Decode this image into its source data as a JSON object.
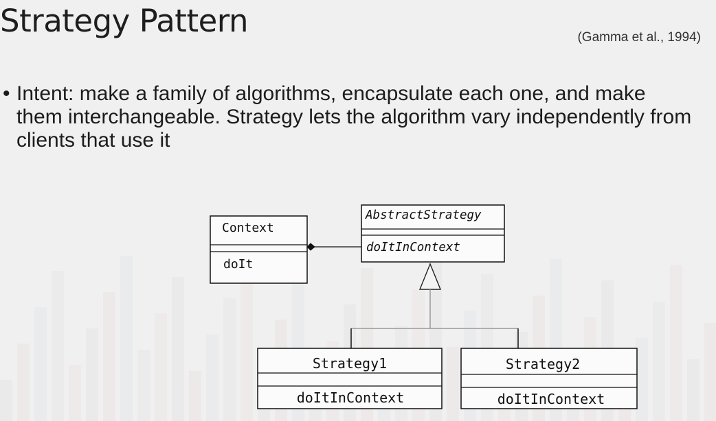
{
  "slide": {
    "title": "Strategy Pattern",
    "citation": "(Gamma et al., 1994)",
    "bullet_symbol": "•",
    "bullet": "Intent: make a family of algorithms, encapsulate each one, and make them interchangeable. Strategy lets the algorithm vary independently from clients that use it"
  },
  "diagram": {
    "context": {
      "name": "Context",
      "method": "doIt"
    },
    "abstract_strategy": {
      "name": "AbstractStrategy",
      "method": "doItInContext"
    },
    "strategy1": {
      "name": "Strategy1",
      "method": "doItInContext"
    },
    "strategy2": {
      "name": "Strategy2",
      "method": "doItInContext"
    },
    "relations": [
      {
        "type": "composition",
        "from": "Context",
        "to": "AbstractStrategy"
      },
      {
        "type": "generalization",
        "from": "Strategy1",
        "to": "AbstractStrategy"
      },
      {
        "type": "generalization",
        "from": "Strategy2",
        "to": "AbstractStrategy"
      }
    ]
  },
  "colors": {
    "background": "#f0f0f0",
    "text": "#1c1c1c",
    "uml_line": "#111111",
    "inheritance_line": "#9a9a9a"
  }
}
